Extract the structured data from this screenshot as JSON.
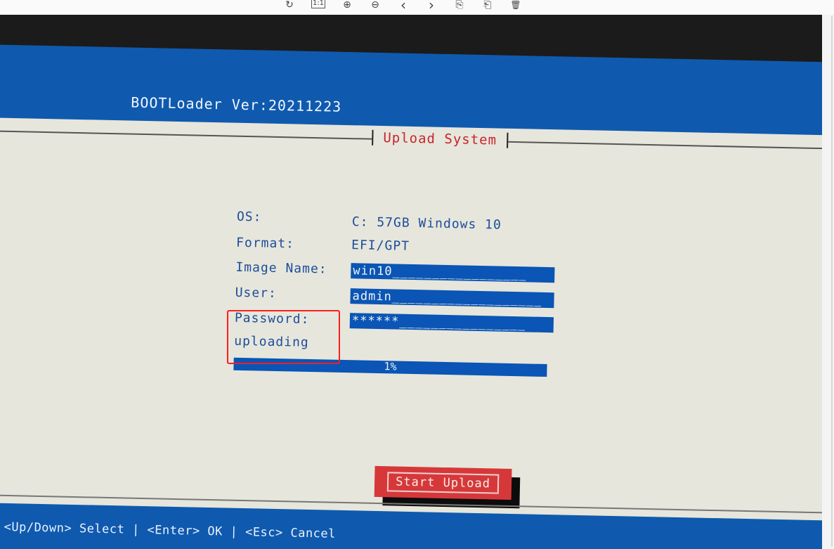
{
  "toolbar": {
    "icons": [
      {
        "name": "rotate-icon",
        "glyph": "↻"
      },
      {
        "name": "actual-size-icon",
        "glyph": "1:1"
      },
      {
        "name": "zoom-in-icon",
        "glyph": "⊕"
      },
      {
        "name": "zoom-out-icon",
        "glyph": "⊖"
      },
      {
        "name": "previous-icon",
        "glyph": "‹"
      },
      {
        "name": "next-icon",
        "glyph": "›"
      },
      {
        "name": "rotate-left-icon",
        "glyph": "⎘"
      },
      {
        "name": "rotate-right-icon",
        "glyph": "⎗"
      },
      {
        "name": "delete-icon",
        "glyph": "🗑"
      }
    ]
  },
  "bios": {
    "title": "BOOTLoader Ver:20211223",
    "dialog_title": "Upload System",
    "os_label": "OS:",
    "os_value": "C: 57GB Windows 10",
    "format_label": "Format:",
    "format_value": "EFI/GPT",
    "image_name_label": "Image Name:",
    "image_name_value": "win10_________________",
    "user_label": "User:",
    "user_value": "admin___________________",
    "password_label": "Password:",
    "password_value": "******________________",
    "status_label": "uploading",
    "progress_text": "1%",
    "progress_value": 0.01,
    "start_button": "Start Upload",
    "status_bar": "<Up/Down> Select | <Enter> OK | <Esc> Cancel"
  },
  "colors": {
    "bios_blue": "#0f5aae",
    "panel_bg": "#e6e6dc",
    "label_text": "#1d4d9a",
    "accent_red": "#c8242a",
    "highlight_red": "#ff1e1e"
  }
}
